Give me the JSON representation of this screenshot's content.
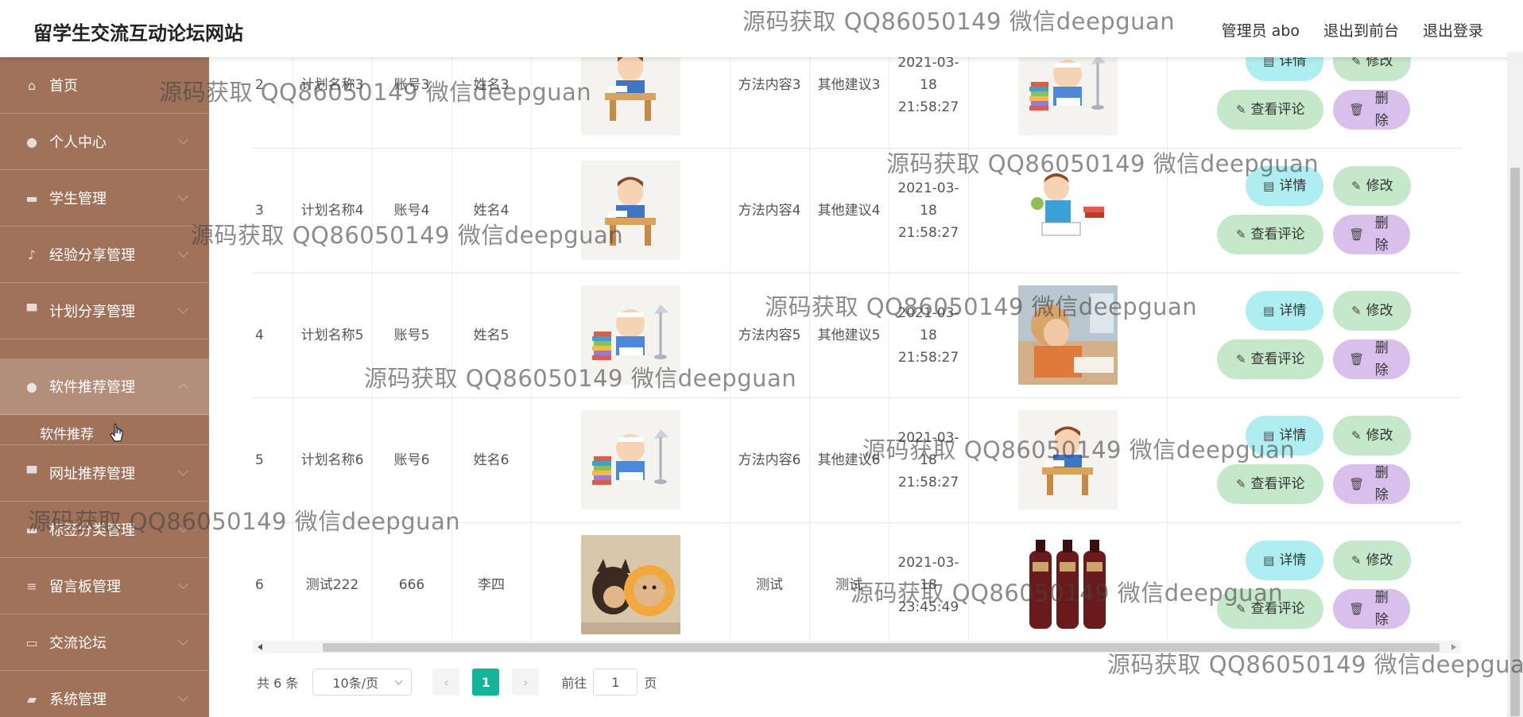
{
  "header": {
    "site_title": "留学生交流互动论坛网站",
    "admin_label": "管理员 abo",
    "front_label": "退出到前台",
    "logout_label": "退出登录"
  },
  "sidebar": {
    "items": [
      {
        "label": "首页",
        "icon": "home-icon"
      },
      {
        "label": "个人中心",
        "icon": "user-icon"
      },
      {
        "label": "学生管理",
        "icon": "student-icon"
      },
      {
        "label": "经验分享管理",
        "icon": "microphone-icon"
      },
      {
        "label": "计划分享管理",
        "icon": "plan-icon"
      },
      {
        "label": "软件推荐管理",
        "icon": "software-icon"
      },
      {
        "label": "网址推荐管理",
        "icon": "link-icon"
      },
      {
        "label": "标签分类管理",
        "icon": "tag-icon"
      },
      {
        "label": "留言板管理",
        "icon": "list-icon"
      },
      {
        "label": "交流论坛",
        "icon": "forum-icon"
      },
      {
        "label": "系统管理",
        "icon": "settings-icon"
      }
    ],
    "submenu_label": "软件推荐"
  },
  "table": {
    "rows": [
      {
        "index": "2",
        "plan": "计划名称3",
        "account": "账号3",
        "name": "姓名3",
        "image": "student-desk",
        "method": "方法内容3",
        "other": "其他建议3",
        "time": "2021-03-18 21:58:27",
        "image2": "boy-books-lamp"
      },
      {
        "index": "3",
        "plan": "计划名称4",
        "account": "账号4",
        "name": "姓名4",
        "image": "student-desk",
        "method": "方法内容4",
        "other": "其他建议4",
        "time": "2021-03-18 21:58:27",
        "image2": "boy-reading"
      },
      {
        "index": "4",
        "plan": "计划名称5",
        "account": "账号5",
        "name": "姓名5",
        "image": "boy-books-lamp",
        "method": "方法内容5",
        "other": "其他建议5",
        "time": "2021-03-18 21:58:27",
        "image2": "child-photo"
      },
      {
        "index": "5",
        "plan": "计划名称6",
        "account": "账号6",
        "name": "姓名6",
        "image": "boy-books-lamp",
        "method": "方法内容6",
        "other": "其他建议6",
        "time": "2021-03-18 21:58:27",
        "image2": "student-desk"
      },
      {
        "index": "6",
        "plan": "测试222",
        "account": "666",
        "name": "李四",
        "image": "dogs-photo",
        "method": "测试",
        "other": "测试",
        "time": "2021-03-18 23:45:49",
        "image2": "shampoo-bottles"
      }
    ],
    "buttons": {
      "detail": "详情",
      "edit": "修改",
      "comment": "查看评论",
      "delete": "删除"
    }
  },
  "pagination": {
    "total": "共 6 条",
    "page_size": "10条/页",
    "current_page": "1",
    "goto_label": "前往",
    "goto_value": "1",
    "page_unit": "页"
  },
  "watermark": "源码获取 QQ86050149 微信deepguan",
  "colors": {
    "sidebar": "#a0725a",
    "detail_button": "#aeeef0",
    "edit_button": "#c4e8c9",
    "delete_button": "#d9c0ec",
    "active_page": "#13b59a"
  }
}
